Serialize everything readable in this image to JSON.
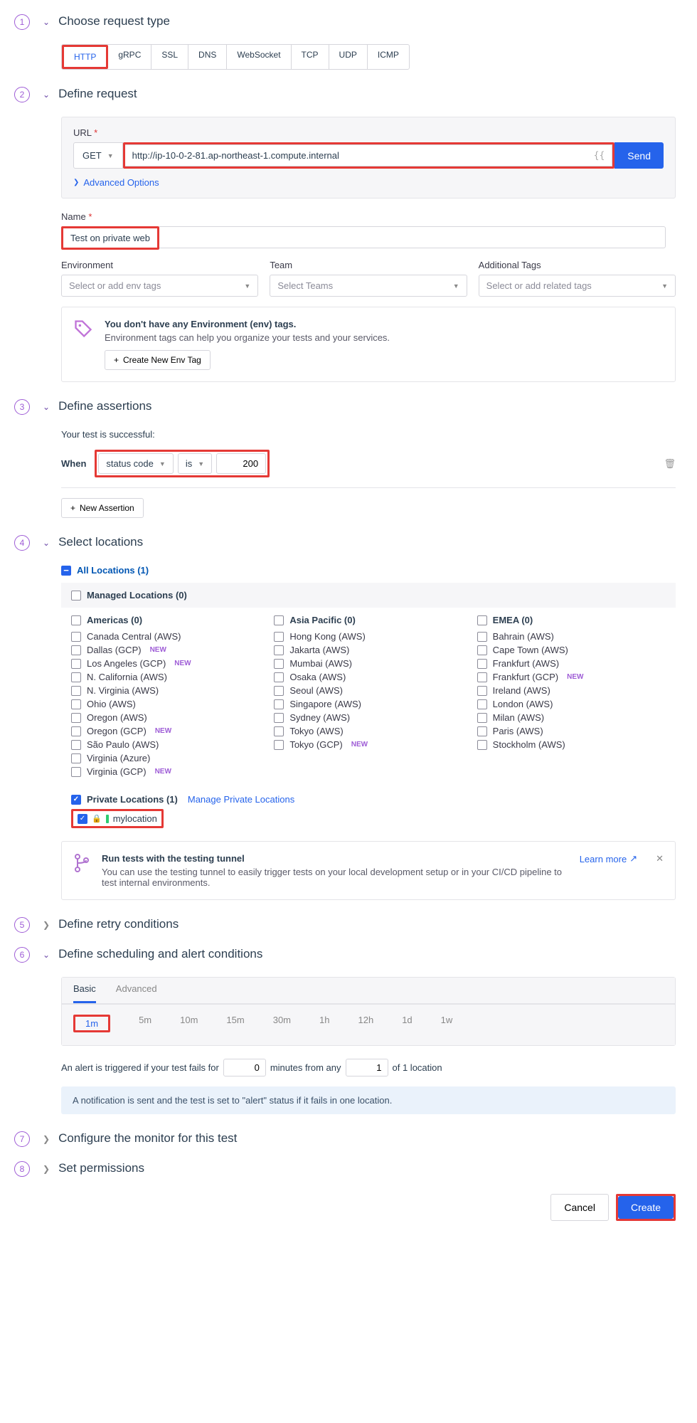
{
  "steps": {
    "s1": {
      "title": "Choose request type"
    },
    "s2": {
      "title": "Define request"
    },
    "s3": {
      "title": "Define assertions"
    },
    "s4": {
      "title": "Select locations"
    },
    "s5": {
      "title": "Define retry conditions"
    },
    "s6": {
      "title": "Define scheduling and alert conditions"
    },
    "s7": {
      "title": "Configure the monitor for this test"
    },
    "s8": {
      "title": "Set permissions"
    }
  },
  "req_types": {
    "http": "HTTP",
    "grpc": "gRPC",
    "ssl": "SSL",
    "dns": "DNS",
    "ws": "WebSocket",
    "tcp": "TCP",
    "udp": "UDP",
    "icmp": "ICMP"
  },
  "define": {
    "url_label": "URL",
    "method": "GET",
    "url_value": "http://ip-10-0-2-81.ap-northeast-1.compute.internal",
    "send": "Send",
    "adv": "Advanced Options",
    "name_label": "Name",
    "name_value": "Test on private web",
    "env_label": "Environment",
    "env_ph": "Select or add env tags",
    "team_label": "Team",
    "team_ph": "Select Teams",
    "tags_label": "Additional Tags",
    "tags_ph": "Select or add related tags",
    "env_banner_title": "You don't have any Environment (env) tags.",
    "env_banner_desc": "Environment tags can help you organize your tests and your services.",
    "env_banner_btn": "Create New Env Tag"
  },
  "assertions": {
    "subtitle": "Your test is successful:",
    "when": "When",
    "type": "status code",
    "op": "is",
    "value": "200",
    "new_btn": "New Assertion"
  },
  "locations": {
    "all": "All Locations (1)",
    "managed": "Managed Locations (0)",
    "col1_head": "Americas (0)",
    "col1": [
      "Canada Central (AWS)",
      "Dallas (GCP)",
      "Los Angeles (GCP)",
      "N. California (AWS)",
      "N. Virginia (AWS)",
      "Ohio (AWS)",
      "Oregon (AWS)",
      "Oregon (GCP)",
      "São Paulo (AWS)",
      "Virginia (Azure)",
      "Virginia (GCP)"
    ],
    "col1_new": [
      false,
      true,
      true,
      false,
      false,
      false,
      false,
      true,
      false,
      false,
      true
    ],
    "col2_head": "Asia Pacific (0)",
    "col2": [
      "Hong Kong (AWS)",
      "Jakarta (AWS)",
      "Mumbai (AWS)",
      "Osaka (AWS)",
      "Seoul (AWS)",
      "Singapore (AWS)",
      "Sydney (AWS)",
      "Tokyo (AWS)",
      "Tokyo (GCP)"
    ],
    "col2_new": [
      false,
      false,
      false,
      false,
      false,
      false,
      false,
      false,
      true
    ],
    "col3_head": "EMEA (0)",
    "col3": [
      "Bahrain (AWS)",
      "Cape Town (AWS)",
      "Frankfurt (AWS)",
      "Frankfurt (GCP)",
      "Ireland (AWS)",
      "London (AWS)",
      "Milan (AWS)",
      "Paris (AWS)",
      "Stockholm (AWS)"
    ],
    "col3_new": [
      false,
      false,
      false,
      true,
      false,
      false,
      false,
      false,
      false
    ],
    "private_head": "Private Locations (1)",
    "manage": "Manage Private Locations",
    "priv_item": "mylocation",
    "tunnel_title": "Run tests with the testing tunnel",
    "tunnel_desc": "You can use the testing tunnel to easily trigger tests on your local development setup or in your CI/CD pipeline to test internal environments.",
    "learn": "Learn more",
    "new_badge": "NEW"
  },
  "sched": {
    "basic": "Basic",
    "advanced": "Advanced",
    "intervals": [
      "1m",
      "5m",
      "10m",
      "15m",
      "30m",
      "1h",
      "12h",
      "1d",
      "1w"
    ],
    "alert_pre": "An alert is triggered if your test fails for",
    "alert_mid": "minutes from any",
    "alert_post": "of 1 location",
    "fail_minutes": "0",
    "fail_locations": "1",
    "info": "A notification is sent and the test is set to \"alert\" status if it fails in one location."
  },
  "footer": {
    "cancel": "Cancel",
    "create": "Create"
  }
}
